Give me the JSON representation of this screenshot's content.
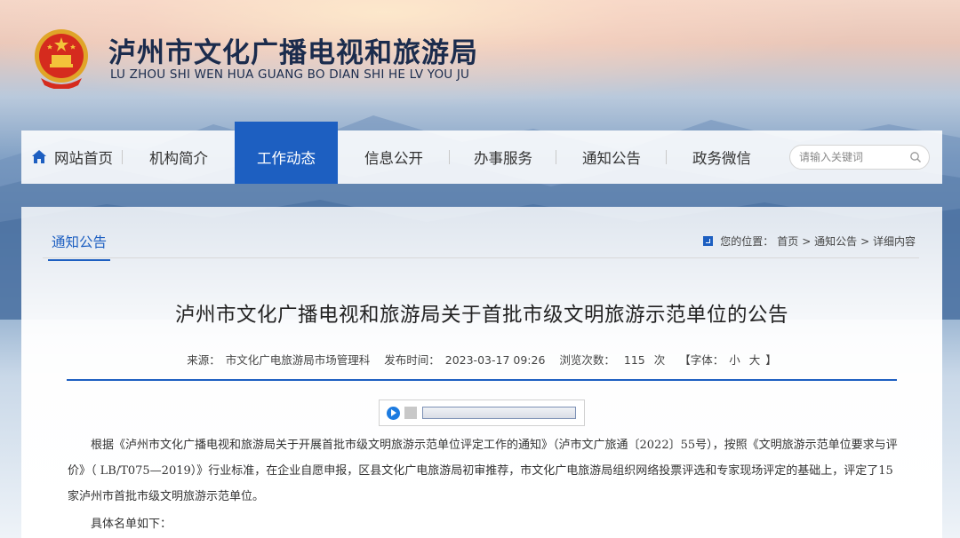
{
  "header": {
    "title_cn": "泸州市文化广播电视和旅游局",
    "title_en": "LU ZHOU SHI  WEN HUA GUANG BO DIAN SHI  HE  LV  YOU  JU",
    "emblem_icon": "national-emblem-icon"
  },
  "nav": {
    "items": [
      {
        "label": "网站首页",
        "icon": "home-icon"
      },
      {
        "label": "机构简介"
      },
      {
        "label": "工作动态",
        "active": true
      },
      {
        "label": "信息公开"
      },
      {
        "label": "办事服务"
      },
      {
        "label": "通知公告"
      },
      {
        "label": "政务微信"
      }
    ],
    "search_placeholder": "请输入关键词"
  },
  "panel": {
    "tab": "通知公告",
    "breadcrumb": {
      "prefix": "您的位置：",
      "items": [
        "首页",
        "> 通知公告",
        "> 详细内容"
      ]
    }
  },
  "article": {
    "title": "泸州市文化广播电视和旅游局关于首批市级文明旅游示范单位的公告",
    "meta": {
      "source_label": "来源：",
      "source": "市文化广电旅游局市场管理科",
      "time_label": "发布时间：",
      "time": "2023-03-17 09:26",
      "views_label": "浏览次数：",
      "views": "115",
      "views_unit": "次",
      "font_label": "【字体：",
      "font_small": "小",
      "font_large": "大",
      "font_close": "】"
    },
    "paragraph1": "根据《泸州市文化广播电视和旅游局关于开展首批市级文明旅游示范单位评定工作的通知》（泸市文广旅通〔2022〕55号），按照《文明旅游示范单位要求与评价》（ LB/T075—2019）》行业标准，在企业自愿申报，区县文化广电旅游局初审推荐，市文化广电旅游局组织网络投票评选和专家现场评定的基础上，评定了15家泸州市首批市级文明旅游示范单位。",
    "paragraph2": "具体名单如下："
  },
  "colors": {
    "accent": "#1d5fc1",
    "title_text": "#1b2c4d"
  }
}
